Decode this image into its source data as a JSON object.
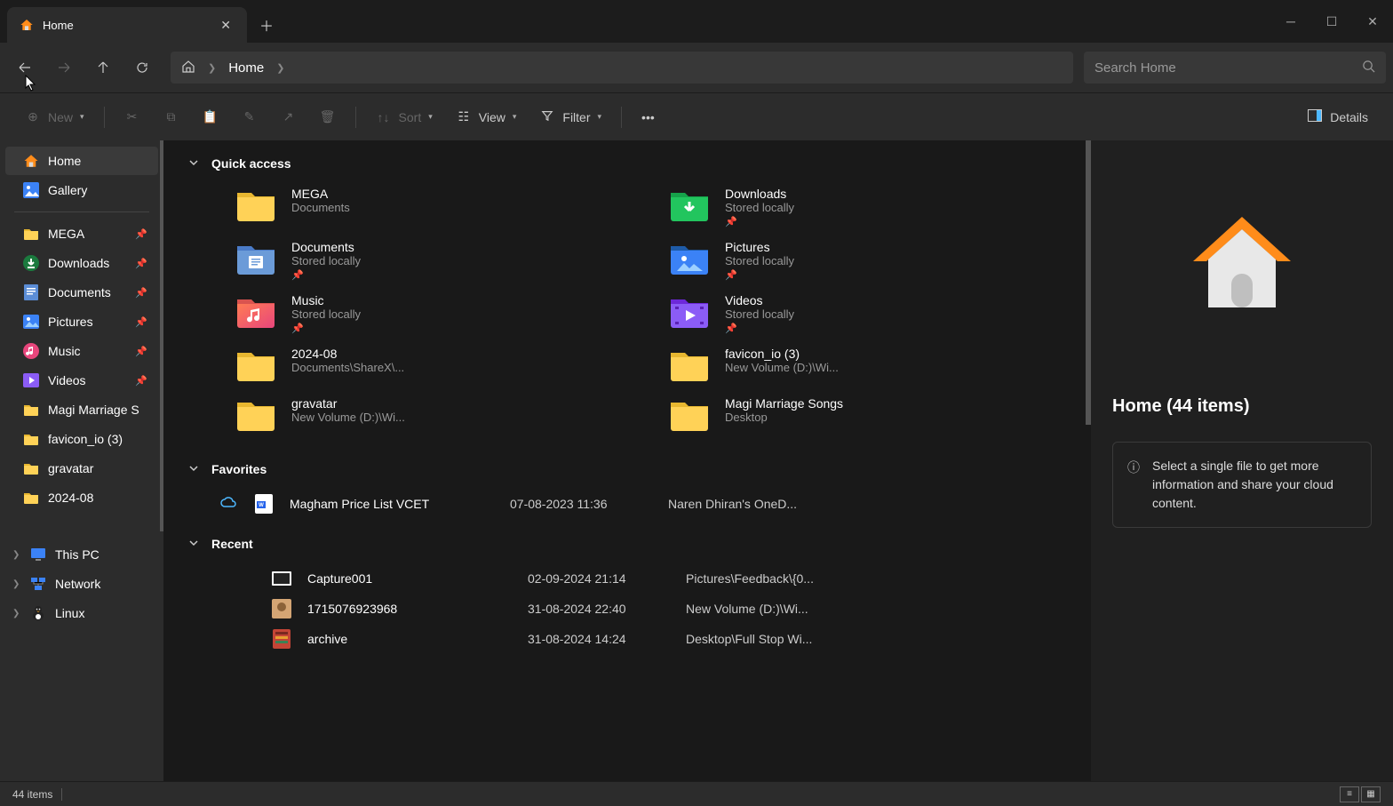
{
  "tab": {
    "title": "Home"
  },
  "breadcrumb": {
    "location": "Home"
  },
  "search": {
    "placeholder": "Search Home"
  },
  "toolbar": {
    "new": "New",
    "sort": "Sort",
    "view": "View",
    "filter": "Filter",
    "details": "Details"
  },
  "sidebar": {
    "top": [
      {
        "label": "Home",
        "icon": "home"
      },
      {
        "label": "Gallery",
        "icon": "gallery"
      }
    ],
    "pinned": [
      {
        "label": "MEGA",
        "icon": "folder",
        "pin": true
      },
      {
        "label": "Downloads",
        "icon": "download",
        "pin": true
      },
      {
        "label": "Documents",
        "icon": "document",
        "pin": true
      },
      {
        "label": "Pictures",
        "icon": "pictures",
        "pin": true
      },
      {
        "label": "Music",
        "icon": "music",
        "pin": true
      },
      {
        "label": "Videos",
        "icon": "videos",
        "pin": true
      },
      {
        "label": "Magi Marriage S",
        "icon": "folder",
        "pin": false
      },
      {
        "label": "favicon_io (3)",
        "icon": "folder",
        "pin": false
      },
      {
        "label": "gravatar",
        "icon": "folder",
        "pin": false
      },
      {
        "label": "2024-08",
        "icon": "folder",
        "pin": false
      }
    ],
    "bottom": [
      {
        "label": "This PC",
        "icon": "pc",
        "expandable": true
      },
      {
        "label": "Network",
        "icon": "network",
        "expandable": true
      },
      {
        "label": "Linux",
        "icon": "linux",
        "expandable": true
      }
    ]
  },
  "sections": {
    "quick_access": "Quick access",
    "favorites": "Favorites",
    "recent": "Recent"
  },
  "quick_access": [
    {
      "name": "MEGA",
      "sub": "Documents",
      "icon": "folder",
      "pin": false
    },
    {
      "name": "Downloads",
      "sub": "Stored locally",
      "icon": "downloads-folder",
      "pin": true
    },
    {
      "name": "Documents",
      "sub": "Stored locally",
      "icon": "documents-folder",
      "pin": true
    },
    {
      "name": "Pictures",
      "sub": "Stored locally",
      "icon": "pictures-folder",
      "pin": true
    },
    {
      "name": "Music",
      "sub": "Stored locally",
      "icon": "music-folder",
      "pin": true
    },
    {
      "name": "Videos",
      "sub": "Stored locally",
      "icon": "videos-folder",
      "pin": true
    },
    {
      "name": "2024-08",
      "sub": "Documents\\ShareX\\...",
      "icon": "folder",
      "pin": false
    },
    {
      "name": "favicon_io (3)",
      "sub": "New Volume (D:)\\Wi...",
      "icon": "folder",
      "pin": false
    },
    {
      "name": "gravatar",
      "sub": "New Volume (D:)\\Wi...",
      "icon": "folder",
      "pin": false
    },
    {
      "name": "Magi Marriage Songs",
      "sub": "Desktop",
      "icon": "folder",
      "pin": false
    }
  ],
  "favorites": [
    {
      "name": "Magham Price List VCET",
      "date": "07-08-2023 11:36",
      "loc": "Naren Dhiran's OneD..."
    }
  ],
  "recent": [
    {
      "name": "Capture001",
      "date": "02-09-2024 21:14",
      "loc": "Pictures\\Feedback\\{0...",
      "icon": "image"
    },
    {
      "name": "1715076923968",
      "date": "31-08-2024 22:40",
      "loc": "New Volume (D:)\\Wi...",
      "icon": "photo"
    },
    {
      "name": "archive",
      "date": "31-08-2024 14:24",
      "loc": "Desktop\\Full Stop Wi...",
      "icon": "archive"
    }
  ],
  "details_pane": {
    "title": "Home (44 items)",
    "info": "Select a single file to get more information and share your cloud content."
  },
  "statusbar": {
    "count": "44 items"
  }
}
